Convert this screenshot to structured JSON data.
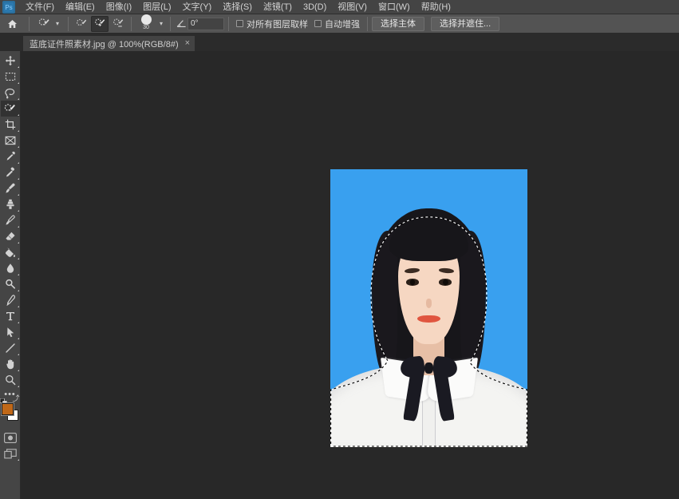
{
  "app": {
    "name": "Adobe Photoshop",
    "logo_text": "Ps",
    "theme_bg": "#323232",
    "accent": "#2a6f9e"
  },
  "menubar": {
    "items": [
      {
        "label": "文件(F)",
        "name": "menu-file"
      },
      {
        "label": "编辑(E)",
        "name": "menu-edit"
      },
      {
        "label": "图像(I)",
        "name": "menu-image"
      },
      {
        "label": "图层(L)",
        "name": "menu-layer"
      },
      {
        "label": "文字(Y)",
        "name": "menu-type"
      },
      {
        "label": "选择(S)",
        "name": "menu-select"
      },
      {
        "label": "滤镜(T)",
        "name": "menu-filter"
      },
      {
        "label": "3D(D)",
        "name": "menu-3d"
      },
      {
        "label": "视图(V)",
        "name": "menu-view"
      },
      {
        "label": "窗口(W)",
        "name": "menu-window"
      },
      {
        "label": "帮助(H)",
        "name": "menu-help"
      }
    ]
  },
  "options_bar": {
    "home_icon": "home-icon",
    "active_tool": "quick-selection-tool",
    "tool_preset_chevron": "chevron-down-icon",
    "selection_modes": [
      {
        "name": "new-selection-mode",
        "icon": "brush-new-selection-icon",
        "active": false
      },
      {
        "name": "add-to-selection-mode",
        "icon": "brush-add-selection-icon",
        "active": true
      },
      {
        "name": "subtract-from-selection-mode",
        "icon": "brush-subtract-selection-icon",
        "active": false
      }
    ],
    "brush_size": "30",
    "brush_chevron": "chevron-down-icon",
    "angle_icon": "angle-icon",
    "angle_value": "0°",
    "sample_all_layers": {
      "label": "对所有图层取样",
      "checked": false
    },
    "auto_enhance": {
      "label": "自动增强",
      "checked": false
    },
    "select_subject_label": "选择主体",
    "select_and_mask_label": "选择并遮住..."
  },
  "tabbar": {
    "tab_title": "蓝底证件照素材.jpg @ 100%(RGB/8#)",
    "close_glyph": "×"
  },
  "toolbar": {
    "tools": [
      {
        "name": "move-tool",
        "icon": "move-icon",
        "selected": false
      },
      {
        "name": "rectangular-marquee-tool",
        "icon": "marquee-icon",
        "selected": false
      },
      {
        "name": "lasso-tool",
        "icon": "lasso-icon",
        "selected": false
      },
      {
        "name": "quick-selection-tool",
        "icon": "quick-selection-icon",
        "selected": true
      },
      {
        "name": "crop-tool",
        "icon": "crop-icon",
        "selected": false
      },
      {
        "name": "frame-tool",
        "icon": "frame-icon",
        "selected": false
      },
      {
        "name": "eyedropper-tool",
        "icon": "eyedropper-icon",
        "selected": false
      },
      {
        "name": "spot-healing-brush-tool",
        "icon": "healing-brush-icon",
        "selected": false
      },
      {
        "name": "brush-tool",
        "icon": "brush-icon",
        "selected": false
      },
      {
        "name": "clone-stamp-tool",
        "icon": "clone-stamp-icon",
        "selected": false
      },
      {
        "name": "history-brush-tool",
        "icon": "history-brush-icon",
        "selected": false
      },
      {
        "name": "eraser-tool",
        "icon": "eraser-icon",
        "selected": false
      },
      {
        "name": "gradient-tool",
        "icon": "paint-bucket-icon",
        "selected": false
      },
      {
        "name": "blur-tool",
        "icon": "blur-drop-icon",
        "selected": false
      },
      {
        "name": "dodge-tool",
        "icon": "dodge-icon",
        "selected": false
      },
      {
        "name": "pen-tool",
        "icon": "pen-icon",
        "selected": false
      },
      {
        "name": "horizontal-type-tool",
        "icon": "type-t-icon",
        "selected": false
      },
      {
        "name": "path-selection-tool",
        "icon": "path-arrow-icon",
        "selected": false
      },
      {
        "name": "line-shape-tool",
        "icon": "line-icon",
        "selected": false
      },
      {
        "name": "hand-tool",
        "icon": "hand-icon",
        "selected": false
      },
      {
        "name": "zoom-tool",
        "icon": "magnifier-icon",
        "selected": false
      },
      {
        "name": "edit-toolbar-more",
        "icon": "ellipsis-icon",
        "selected": false
      }
    ],
    "foreground_color": "#c06818",
    "background_color": "#ffffff",
    "swap_colors_icon": "swap-colors-icon",
    "default_colors_icon": "default-colors-icon",
    "quick_mask_icon": "quick-mask-icon",
    "screen_mode_icon": "screen-mode-icon"
  },
  "canvas": {
    "background": "#282828",
    "document": {
      "photo_background_color": "#39a0ef",
      "zoom_level": "100%",
      "color_mode": "RGB/8",
      "has_active_selection": true,
      "selection_description": "marching-ants selection around person"
    }
  }
}
